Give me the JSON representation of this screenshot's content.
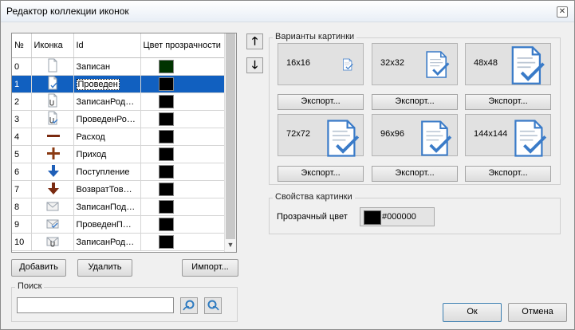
{
  "window": {
    "title": "Редактор коллекции иконок",
    "close_glyph": "✕"
  },
  "grid": {
    "columns": [
      "№",
      "Иконка",
      "Id",
      "Цвет прозрачности"
    ],
    "selected_index": 1,
    "rows": [
      {
        "num": "0",
        "icon": "doc-icon",
        "id": "Записан",
        "color": "#003300"
      },
      {
        "num": "1",
        "icon": "doc-check-icon",
        "id": "Проведен",
        "color": "#000000"
      },
      {
        "num": "2",
        "icon": "doc-clip-icon",
        "id": "ЗаписанРод…",
        "color": "#000000"
      },
      {
        "num": "3",
        "icon": "doc-clip-check-icon",
        "id": "ПроведенРо…",
        "color": "#000000"
      },
      {
        "num": "4",
        "icon": "minus-icon",
        "id": "Расход",
        "color": "#000000"
      },
      {
        "num": "5",
        "icon": "plus-icon",
        "id": "Приход",
        "color": "#000000"
      },
      {
        "num": "6",
        "icon": "arrow-down-blue-icon",
        "id": "Поступление",
        "color": "#000000"
      },
      {
        "num": "7",
        "icon": "arrow-down-brown-icon",
        "id": "ВозвратТов…",
        "color": "#000000"
      },
      {
        "num": "8",
        "icon": "envelope-icon",
        "id": "ЗаписанПод…",
        "color": "#000000"
      },
      {
        "num": "9",
        "icon": "envelope-check-icon",
        "id": "ПроведенП…",
        "color": "#000000"
      },
      {
        "num": "10",
        "icon": "envelope-clip-icon",
        "id": "ЗаписанРод…",
        "color": "#000000"
      }
    ]
  },
  "move": {
    "up": "🡑",
    "down": "🡓"
  },
  "buttons": {
    "add": "Добавить",
    "delete": "Удалить",
    "import": "Импорт...",
    "ok": "Ок",
    "cancel": "Отмена"
  },
  "variants": {
    "title": "Варианты картинки",
    "export_label": "Экспорт...",
    "tiles": [
      {
        "size": "16x16"
      },
      {
        "size": "32x32"
      },
      {
        "size": "48x48"
      },
      {
        "size": "72x72"
      },
      {
        "size": "96x96"
      },
      {
        "size": "144x144"
      }
    ]
  },
  "properties": {
    "title": "Свойства картинки",
    "transparent_label": "Прозрачный цвет",
    "transparent_value": "#000000"
  },
  "search": {
    "title": "Поиск",
    "value": ""
  },
  "colors": {
    "selection": "#1160c0",
    "check": "#3a7bc8"
  }
}
